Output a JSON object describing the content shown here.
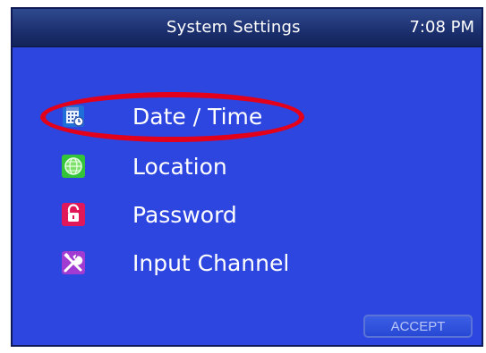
{
  "header": {
    "title": "System Settings",
    "clock": "7:08 PM"
  },
  "menu": {
    "items": [
      {
        "label": "Date / Time",
        "icon": "calendar-icon",
        "color": "#1e70d8",
        "highlighted": true
      },
      {
        "label": "Location",
        "icon": "globe-icon",
        "color": "#33c43a"
      },
      {
        "label": "Password",
        "icon": "lock-icon",
        "color": "#e0185a"
      },
      {
        "label": "Input Channel",
        "icon": "tools-icon",
        "color": "#a23bd1"
      }
    ]
  },
  "footer": {
    "accept_label": "ACCEPT"
  },
  "colors": {
    "screen_background": "#2e46e0",
    "header_background": "#1b2f6e",
    "highlight": "#e3001b"
  }
}
